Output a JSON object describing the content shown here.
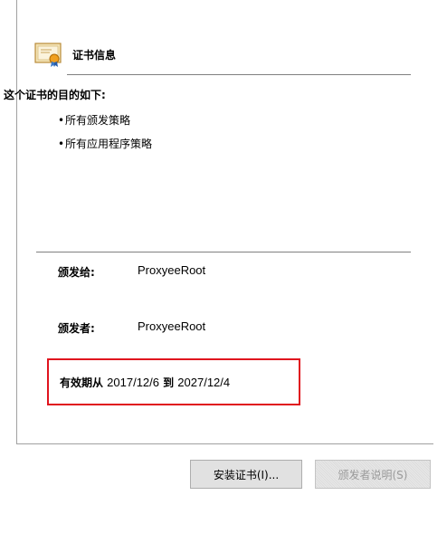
{
  "header": {
    "icon": "certificate-icon",
    "title": "证书信息"
  },
  "purposes": {
    "heading": "这个证书的目的如下:",
    "items": [
      {
        "bullet": "•",
        "label": "所有颁发策略"
      },
      {
        "bullet": "•",
        "label": "所有应用程序策略"
      }
    ]
  },
  "fields": {
    "issued_to_label": "颁发给:",
    "issued_to_value": "ProxyeeRoot",
    "issued_by_label": "颁发者:",
    "issued_by_value": "ProxyeeRoot"
  },
  "validity": {
    "from_label": "有效期从",
    "from_value": "2017/12/6",
    "to_label": "到",
    "to_value": "2027/12/4",
    "highlight_color": "#e0141e"
  },
  "buttons": {
    "install": "安装证书(I)...",
    "issuer_statement": "颁发者说明(S)",
    "issuer_statement_enabled": false
  }
}
